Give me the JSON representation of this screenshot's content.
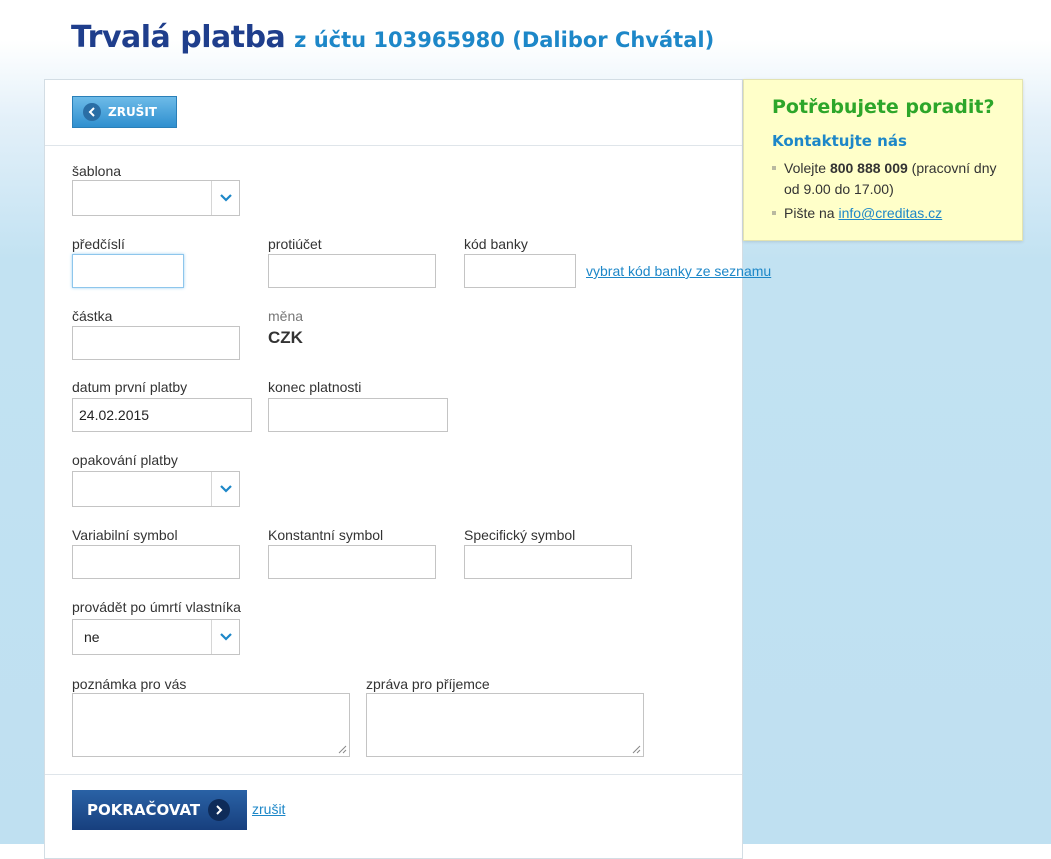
{
  "header": {
    "title": "Trvalá platba",
    "subtitle": "z účtu 103965980 (Dalibor Chvátal)"
  },
  "toolbar": {
    "cancel_label": "ZRUŠIT"
  },
  "form": {
    "template": {
      "label": "šablona",
      "value": ""
    },
    "prefix": {
      "label": "předčíslí",
      "value": ""
    },
    "account": {
      "label": "protiúčet",
      "value": ""
    },
    "bank_code": {
      "label": "kód banky",
      "value": "",
      "link": "vybrat kód banky ze seznamu"
    },
    "amount": {
      "label": "částka",
      "value": ""
    },
    "currency": {
      "label": "měna",
      "value": "CZK"
    },
    "first_payment_date": {
      "label": "datum první platby",
      "value": "24.02.2015"
    },
    "valid_until": {
      "label": "konec platnosti",
      "value": ""
    },
    "repeat": {
      "label": "opakování platby",
      "value": ""
    },
    "variable_symbol": {
      "label": "Variabilní symbol",
      "value": ""
    },
    "constant_symbol": {
      "label": "Konstantní symbol",
      "value": ""
    },
    "specific_symbol": {
      "label": "Specifický symbol",
      "value": ""
    },
    "after_death": {
      "label": "provádět po úmrtí vlastníka",
      "value": "ne"
    },
    "note_self": {
      "label": "poznámka pro vás",
      "value": ""
    },
    "note_recipient": {
      "label": "zpráva pro příjemce",
      "value": ""
    }
  },
  "footer": {
    "continue_label": "POKRAČOVAT",
    "cancel_link": "zrušit"
  },
  "help": {
    "title": "Potřebujete poradit?",
    "subtitle": "Kontaktujte nás",
    "call_prefix": "Volejte ",
    "phone": "800 888 009",
    "call_suffix": " (pracovní dny od 9.00 do 17.00)",
    "write_prefix": "Pište na ",
    "email": "info@creditas.cz"
  },
  "colors": {
    "brand_dark": "#1f3e8c",
    "brand_light": "#1d87c8",
    "help_title": "#2da62a",
    "help_bg": "#ffffc9"
  }
}
